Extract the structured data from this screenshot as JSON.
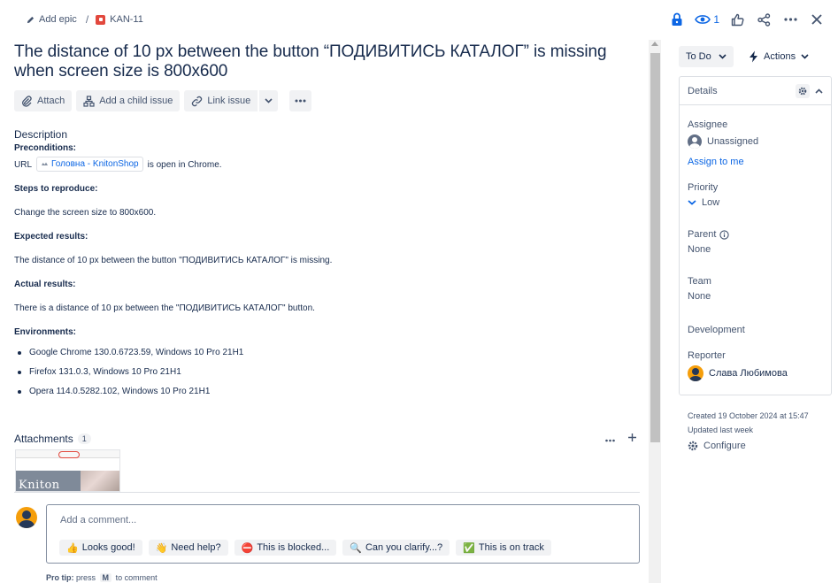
{
  "breadcrumb": {
    "add_epic": "Add epic",
    "separator": "/",
    "issue_key": "KAN-11"
  },
  "top_actions": {
    "watch_count": "1",
    "icons": [
      "lock-icon",
      "eye-icon",
      "thumbs-up-icon",
      "share-icon",
      "more-icon",
      "close-icon"
    ]
  },
  "issue": {
    "title": "The distance of 10 px between the button “ПОДИВИТИСЬ КАТАЛОГ” is missing when screen size is 800x600"
  },
  "toolbar": {
    "attach": "Attach",
    "add_child": "Add a child issue",
    "link_issue": "Link issue"
  },
  "description": {
    "heading": "Description",
    "preconditions_label": "Preconditions:",
    "url_prefix": "URL",
    "url_link": "Головна - KnitonShop",
    "url_suffix": "is open in Chrome.",
    "steps_label": "Steps to reproduce:",
    "steps_text": "Change the screen size to 800x600.",
    "expected_label": "Expected results:",
    "expected_text": "The distance of 10 px between the button \"ПОДИВИТИСЬ КАТАЛОГ\" is missing.",
    "actual_label": "Actual results:",
    "actual_text": "There is a distance of 10 px between the \"ПОДИВИТИСЬ КАТАЛОГ\" button.",
    "env_label": "Environments:",
    "environments": [
      "Google Chrome 130.0.6723.59, Windows 10 Pro 21H1",
      "Firefox 131.0.3, Windows 10 Pro 21H1",
      "Opera 114.0.5282.102, Windows 10 Pro 21H1"
    ]
  },
  "attachments": {
    "heading": "Attachments",
    "count": "1",
    "thumb_logo": "Kniton"
  },
  "comment": {
    "placeholder": "Add a comment...",
    "quick_replies": [
      {
        "emoji": "👍",
        "label": "Looks good!"
      },
      {
        "emoji": "👋",
        "label": "Need help?"
      },
      {
        "emoji": "⛔",
        "label": "This is blocked..."
      },
      {
        "emoji": "🔍",
        "label": "Can you clarify...?"
      },
      {
        "emoji": "✅",
        "label": "This is on track"
      }
    ],
    "protip_bold": "Pro tip:",
    "protip_press": "press",
    "protip_key": "M",
    "protip_rest": "to comment"
  },
  "sidebar": {
    "status": "To Do",
    "actions": "Actions",
    "details_title": "Details",
    "assignee_label": "Assignee",
    "assignee_value": "Unassigned",
    "assign_to_me": "Assign to me",
    "priority_label": "Priority",
    "priority_value": "Low",
    "parent_label": "Parent",
    "parent_value": "None",
    "team_label": "Team",
    "team_value": "None",
    "development_label": "Development",
    "reporter_label": "Reporter",
    "reporter_value": "Слава Любимова",
    "created": "Created 19 October 2024 at 15:47",
    "updated": "Updated last week",
    "configure": "Configure"
  },
  "colors": {
    "accent": "#0c66e4",
    "priority_low": "#0c66e4",
    "issue_type": "#e2483d",
    "avatar": "#f59e0b"
  }
}
